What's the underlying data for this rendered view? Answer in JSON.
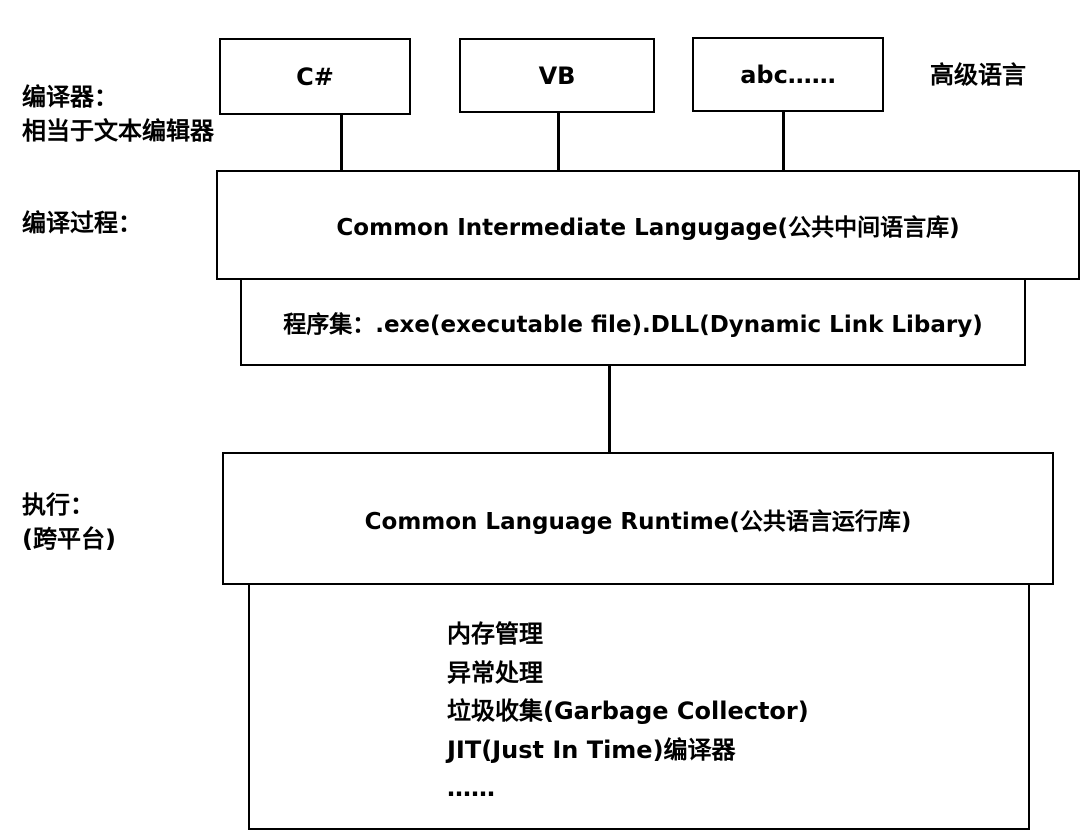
{
  "labels": {
    "compiler_line1": "编译器：",
    "compiler_line2": "相当于文本编辑器",
    "high_level_language": "高级语言",
    "compile_process": "编译过程：",
    "execute_line1": "执行：",
    "execute_line2": "(跨平台)"
  },
  "languages": [
    "C#",
    "VB",
    "abc……"
  ],
  "cil": "Common Intermediate Langugage(公共中间语言库)",
  "assembly": "程序集：.exe(executable file).DLL(Dynamic Link Libary)",
  "clr": "Common Language Runtime(公共语言运行库)",
  "clr_features": [
    "内存管理",
    "异常处理",
    "垃圾收集(Garbage Collector)",
    "JIT(Just In Time)编译器",
    "……"
  ]
}
